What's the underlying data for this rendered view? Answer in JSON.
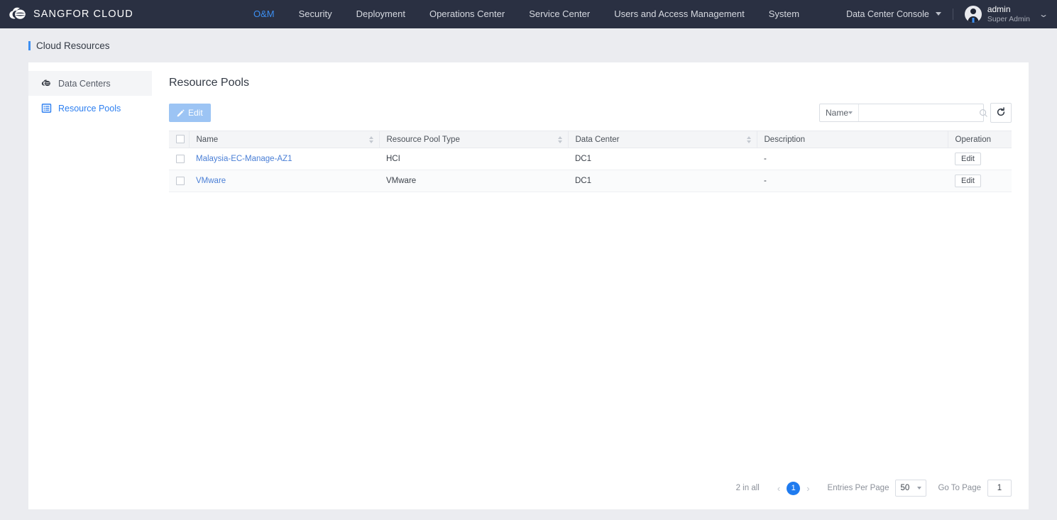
{
  "brand": {
    "name": "SANGFOR CLOUD",
    "logo_icon": "cloud-logo-icon"
  },
  "topnav": {
    "items": [
      {
        "label": "O&M",
        "active": true
      },
      {
        "label": "Security",
        "active": false
      },
      {
        "label": "Deployment",
        "active": false
      },
      {
        "label": "Operations Center",
        "active": false
      },
      {
        "label": "Service Center",
        "active": false
      },
      {
        "label": "Users and Access Management",
        "active": false
      },
      {
        "label": "System",
        "active": false
      }
    ],
    "console_selector": "Data Center Console",
    "user": {
      "name": "admin",
      "role": "Super Admin"
    }
  },
  "breadcrumb": {
    "text": "Cloud Resources"
  },
  "sidebar": {
    "items": [
      {
        "label": "Data Centers",
        "icon": "cloud-disc-icon",
        "selected": false
      },
      {
        "label": "Resource Pools",
        "icon": "list-document-icon",
        "selected": true
      }
    ]
  },
  "main": {
    "title": "Resource Pools",
    "toolbar": {
      "edit_label": "Edit",
      "edit_icon": "pencil-icon",
      "edit_disabled": true
    },
    "search": {
      "field_label": "Name",
      "input_value": "",
      "input_placeholder": "",
      "search_icon": "magnifier-icon",
      "refresh_icon": "refresh-icon"
    },
    "table": {
      "columns": [
        {
          "key": "name",
          "label": "Name",
          "sortable": true
        },
        {
          "key": "type",
          "label": "Resource Pool Type",
          "sortable": true
        },
        {
          "key": "datacenter",
          "label": "Data Center",
          "sortable": true
        },
        {
          "key": "description",
          "label": "Description",
          "sortable": false
        },
        {
          "key": "operation",
          "label": "Operation",
          "sortable": false
        }
      ],
      "rows": [
        {
          "name": "Malaysia-EC-Manage-AZ1",
          "type": "HCI",
          "datacenter": "DC1",
          "description": "-",
          "operation": "Edit"
        },
        {
          "name": "VMware",
          "type": "VMware",
          "datacenter": "DC1",
          "description": "-",
          "operation": "Edit"
        }
      ]
    },
    "pagination": {
      "total_text": "2 in all",
      "prev_icon": "chevron-left-icon",
      "next_icon": "chevron-right-icon",
      "current_page": "1",
      "entries_label": "Entries Per Page",
      "entries_value": "50",
      "goto_label": "Go To Page",
      "goto_value": "1"
    }
  },
  "colors": {
    "header_bg": "#2a3042",
    "accent_blue": "#3d8ff2",
    "page_bg": "#ebecf0",
    "panel_bg": "#ffffff",
    "link_blue": "#4a7fd6",
    "btn_disabled_blue": "#9cc4f4",
    "pager_active": "#1f7bef"
  }
}
